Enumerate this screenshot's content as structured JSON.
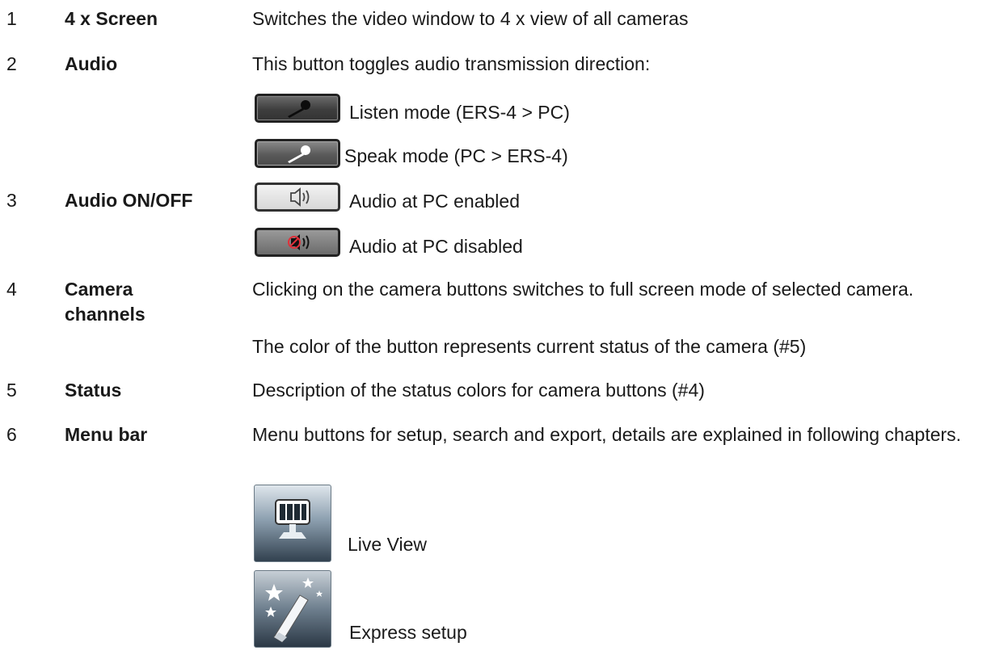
{
  "rows": [
    {
      "number": "1",
      "term": "4 x Screen",
      "description": "Switches the video window to 4 x view of all cameras"
    },
    {
      "number": "2",
      "term": "Audio",
      "description": "This button toggles audio transmission direction:"
    },
    {
      "number": "3",
      "term": "Audio ON/OFF"
    },
    {
      "number": "4",
      "term_line1": "Camera",
      "term_line2": "channels",
      "description": "Clicking on the camera buttons switches to full screen mode of selected camera.",
      "description2": "The color of the button represents current status of the camera (#5)"
    },
    {
      "number": "5",
      "term": "Status",
      "description": "Description of the status colors for camera buttons (#4)"
    },
    {
      "number": "6",
      "term": "Menu bar",
      "description": "Menu buttons for setup, search and export, details are explained in following chapters."
    }
  ],
  "audio_modes": {
    "listen": {
      "icon": "microphone-icon",
      "caption": "Listen mode (ERS-4 > PC)"
    },
    "speak": {
      "icon": "microphone-icon",
      "caption": "Speak mode (PC > ERS-4)"
    }
  },
  "audio_states": {
    "enabled": {
      "icon": "speaker-icon",
      "caption": "Audio at PC  enabled"
    },
    "disabled": {
      "icon": "speaker-muted-icon",
      "caption": "Audio at PC  disabled"
    }
  },
  "menu_items": {
    "live_view": {
      "icon": "monitor-icon",
      "caption": "Live View"
    },
    "express_setup": {
      "icon": "magic-wand-icon",
      "caption": "Express setup"
    }
  }
}
